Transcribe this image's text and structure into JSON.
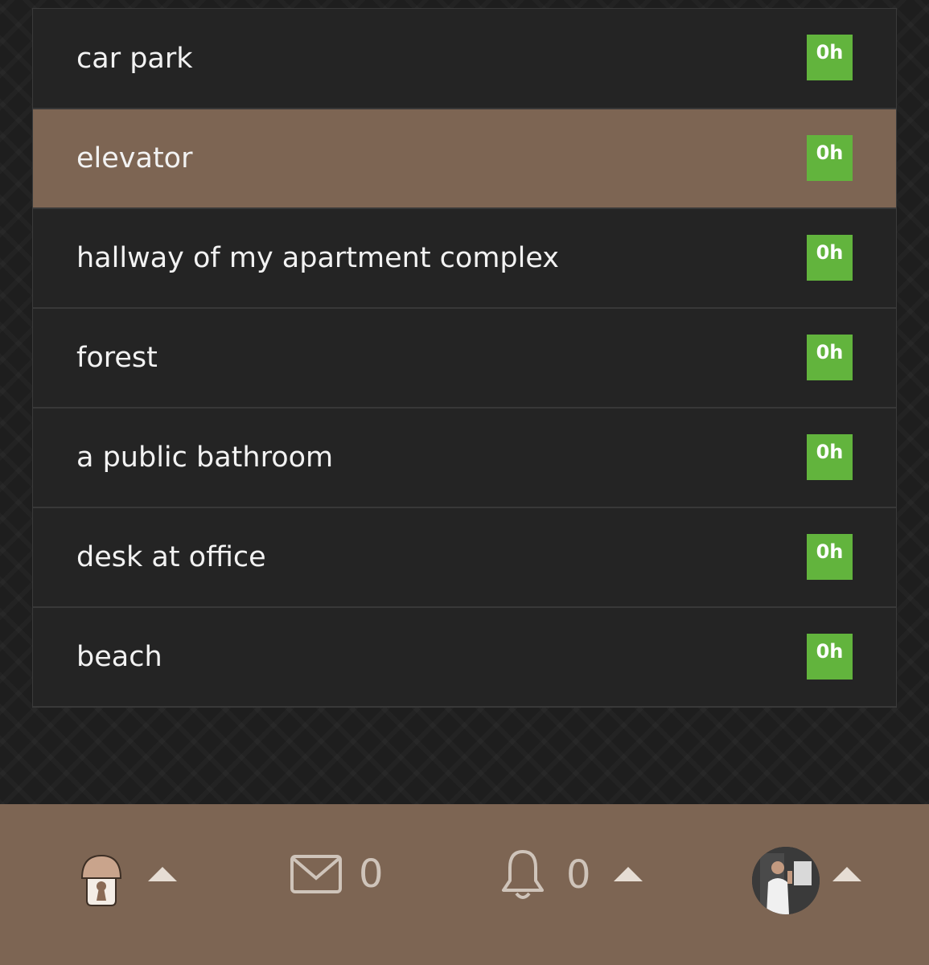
{
  "list": {
    "items": [
      {
        "label": "car park",
        "badge": "0h",
        "active": false
      },
      {
        "label": "elevator",
        "badge": "0h",
        "active": true
      },
      {
        "label": "hallway of my apartment complex",
        "badge": "0h",
        "active": false
      },
      {
        "label": "forest",
        "badge": "0h",
        "active": false
      },
      {
        "label": "a public bathroom",
        "badge": "0h",
        "active": false
      },
      {
        "label": "desk at office",
        "badge": "0h",
        "active": false
      },
      {
        "label": "beach",
        "badge": "0h",
        "active": false
      }
    ]
  },
  "bottombar": {
    "messages_count": "0",
    "notifications_count": "0",
    "icons": [
      "mushroom-house-icon",
      "envelope-icon",
      "bell-icon",
      "avatar"
    ]
  },
  "colors": {
    "active_row": "#7d6553",
    "row": "#242424",
    "badge": "#62b43d",
    "bottombar": "#7d6553"
  }
}
